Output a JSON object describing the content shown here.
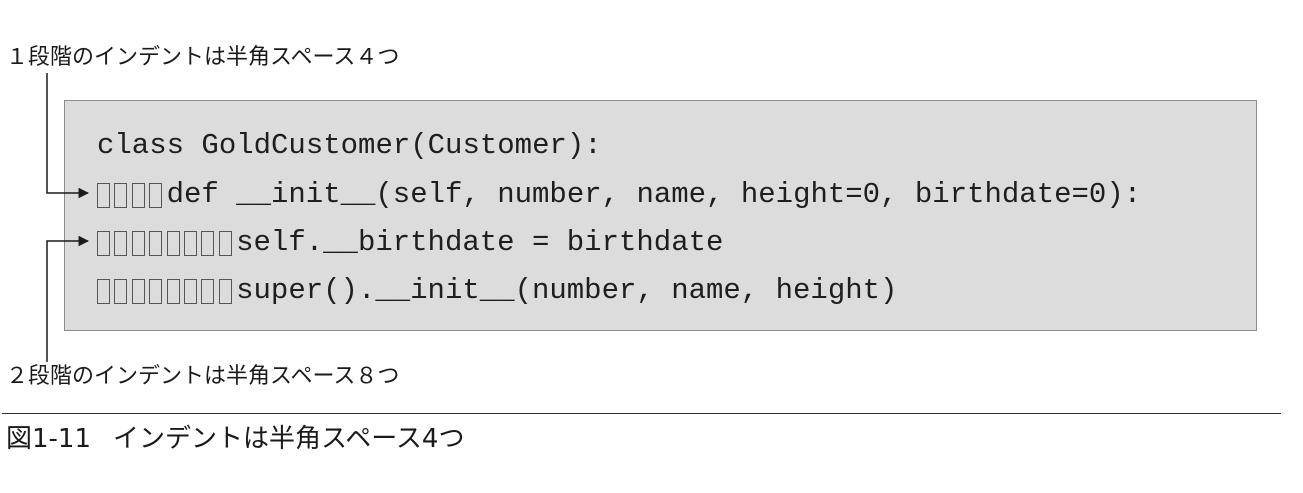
{
  "annotations": {
    "top": "１段階のインデントは半角スペース４つ",
    "bottom": "２段階のインデントは半角スペース８つ"
  },
  "code": {
    "lines": [
      {
        "indent_spaces": 0,
        "text": "class GoldCustomer(Customer):"
      },
      {
        "indent_spaces": 4,
        "text": "def __init__(self, number, name, height=0, birthdate=0):"
      },
      {
        "indent_spaces": 8,
        "text": "self.__birthdate = birthdate"
      },
      {
        "indent_spaces": 8,
        "text": "super().__init__(number, name, height)"
      }
    ]
  },
  "caption": {
    "figure_number": "図1-11",
    "text": "インデントは半角スペース4つ"
  },
  "colors": {
    "code_background": "#dcdcdc",
    "code_border": "#8c8c8c",
    "text": "#1a1a1a",
    "space_mark_border": "#555555"
  }
}
